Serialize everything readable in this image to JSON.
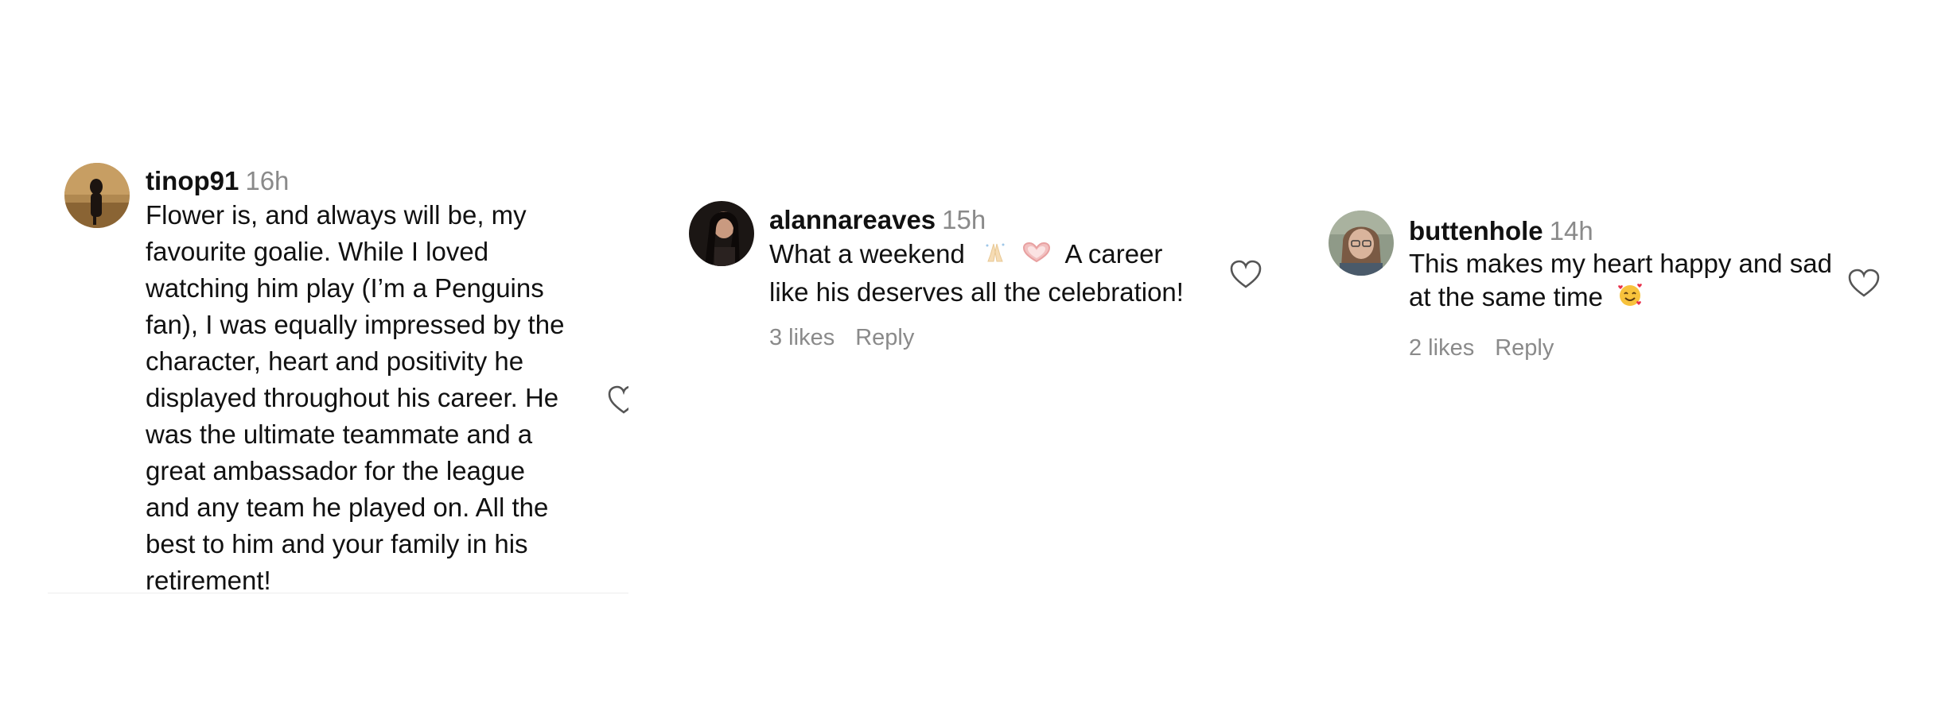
{
  "comments": [
    {
      "username": "tinop91",
      "time": "16h",
      "text_lines": [
        "Flower is, and always will be, my",
        "favourite goalie. While I loved",
        "watching him play (I’m a Penguins",
        "fan), I was equally impressed by the",
        "character, heart and positivity he",
        "displayed throughout his career. He",
        "was the ultimate teammate and a",
        "great ambassador for the league",
        "and any team he played on. All the",
        "best to him and your family in his",
        "retirement!"
      ]
    },
    {
      "username": "alannareaves",
      "time": "15h",
      "text_line1_a": "What a weekend",
      "text_line1_b": "A career",
      "text_line2": "like his deserves all the celebration!",
      "emojis": [
        "folded-hands-emoji",
        "heart-hands-emoji"
      ],
      "likes": "3 likes",
      "reply": "Reply"
    },
    {
      "username": "buttenhole",
      "time": "14h",
      "text_line1": "This makes my heart happy and sad",
      "text_line2": "at the same time",
      "emojis": [
        "smiling-face-with-hearts-emoji"
      ],
      "likes": "2 likes",
      "reply": "Reply"
    }
  ]
}
